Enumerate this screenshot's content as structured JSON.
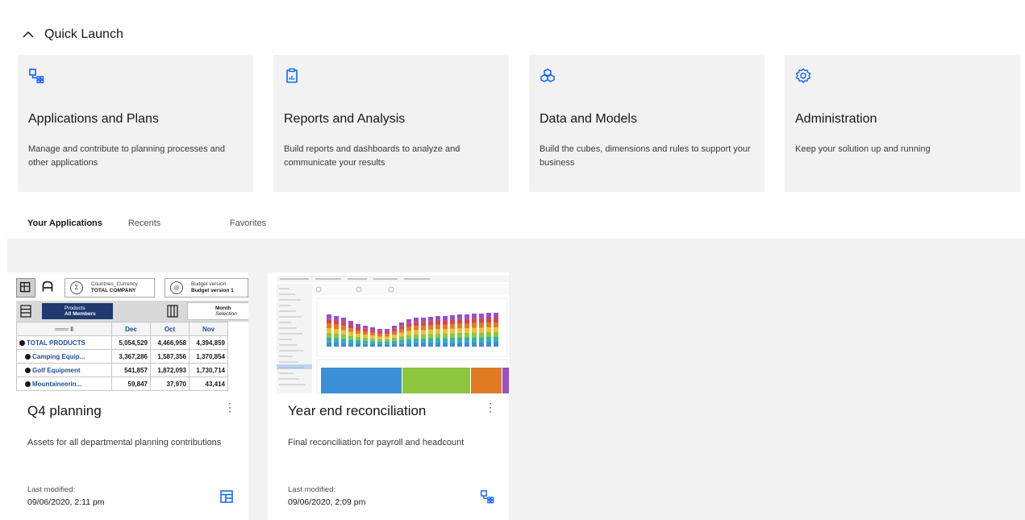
{
  "quick_launch": {
    "title": "Quick Launch",
    "tiles": [
      {
        "title": "Applications and Plans",
        "description": "Manage and contribute to planning processes and other applications",
        "icon": "applications-icon"
      },
      {
        "title": "Reports and Analysis",
        "description": "Build reports and dashboards to analyze and communicate your results",
        "icon": "report-icon"
      },
      {
        "title": "Data and Models",
        "description": "Build the cubes, dimensions and rules to support your business",
        "icon": "cubes-icon"
      },
      {
        "title": "Administration",
        "description": "Keep your solution up and running",
        "icon": "gear-icon"
      }
    ]
  },
  "tabs": [
    {
      "label": "Your Applications",
      "active": true
    },
    {
      "label": "Recents",
      "active": false
    },
    {
      "label": "Favorites",
      "active": false
    }
  ],
  "applications": [
    {
      "title": "Q4 planning",
      "description": "Assets for all departmental planning contributions",
      "modified_label": "Last modified:",
      "modified_date": "09/06/2020, 2:11 pm",
      "type_icon": "plan-icon",
      "preview": {
        "dim1_name": "Countries_Currency",
        "dim1_value": "TOTAL COMPANY",
        "dim2_name": "Budget version",
        "dim2_value": "Budget version 1",
        "rows_dim_name": "Products",
        "rows_dim_value": "All Members",
        "cols_dim_name": "Month",
        "cols_dim_value": "Selection",
        "columns": [
          "Dec",
          "Oct",
          "Nov"
        ],
        "rows": [
          {
            "label": "TOTAL PRODUCTS",
            "values": [
              "5,054,529",
              "4,466,958",
              "4,394,859"
            ]
          },
          {
            "label": "Camping Equip...",
            "values": [
              "3,367,286",
              "1,587,356",
              "1,370,854"
            ]
          },
          {
            "label": "Golf Equipment",
            "values": [
              "541,857",
              "1,872,093",
              "1,730,714"
            ]
          },
          {
            "label": "Mountaineerin...",
            "values": [
              "59,847",
              "37,970",
              "43,414"
            ]
          }
        ]
      }
    },
    {
      "title": "Year end reconciliation",
      "description": "Final reconciliation for payroll and headcount",
      "modified_label": "Last modified:",
      "modified_date": "09/06/2020, 2:09 pm",
      "type_icon": "applications-icon"
    }
  ],
  "colors": {
    "accent": "#0f62fe",
    "tile_bg": "#f2f2f2",
    "area_bg": "#f2f2f2"
  }
}
